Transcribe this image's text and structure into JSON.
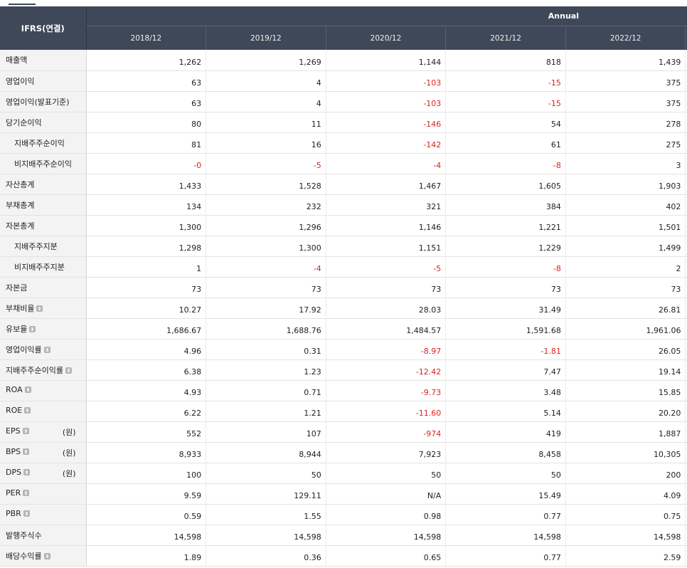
{
  "header": {
    "corner_label": "IFRS(연결)",
    "group_label": "Annual",
    "years": [
      "2018/12",
      "2019/12",
      "2020/12",
      "2021/12",
      "2022/12"
    ]
  },
  "rows": [
    {
      "label": "매출액",
      "sub": false,
      "info": false,
      "unit": "",
      "values": [
        "1,262",
        "1,269",
        "1,144",
        "818",
        "1,439"
      ]
    },
    {
      "label": "영업이익",
      "sub": false,
      "info": false,
      "unit": "",
      "values": [
        "63",
        "4",
        "-103",
        "-15",
        "375"
      ]
    },
    {
      "label": "영업이익(발표기준)",
      "sub": false,
      "info": false,
      "unit": "",
      "values": [
        "63",
        "4",
        "-103",
        "-15",
        "375"
      ]
    },
    {
      "label": "당기순이익",
      "sub": false,
      "info": false,
      "unit": "",
      "values": [
        "80",
        "11",
        "-146",
        "54",
        "278"
      ]
    },
    {
      "label": "지배주주순이익",
      "sub": true,
      "info": false,
      "unit": "",
      "values": [
        "81",
        "16",
        "-142",
        "61",
        "275"
      ]
    },
    {
      "label": "비지배주주순이익",
      "sub": true,
      "info": false,
      "unit": "",
      "values": [
        "-0",
        "-5",
        "-4",
        "-8",
        "3"
      ]
    },
    {
      "label": "자산총계",
      "sub": false,
      "info": false,
      "unit": "",
      "values": [
        "1,433",
        "1,528",
        "1,467",
        "1,605",
        "1,903"
      ]
    },
    {
      "label": "부채총계",
      "sub": false,
      "info": false,
      "unit": "",
      "values": [
        "134",
        "232",
        "321",
        "384",
        "402"
      ]
    },
    {
      "label": "자본총계",
      "sub": false,
      "info": false,
      "unit": "",
      "values": [
        "1,300",
        "1,296",
        "1,146",
        "1,221",
        "1,501"
      ]
    },
    {
      "label": "지배주주지분",
      "sub": true,
      "info": false,
      "unit": "",
      "values": [
        "1,298",
        "1,300",
        "1,151",
        "1,229",
        "1,499"
      ]
    },
    {
      "label": "비지배주주지분",
      "sub": true,
      "info": false,
      "unit": "",
      "values": [
        "1",
        "-4",
        "-5",
        "-8",
        "2"
      ]
    },
    {
      "label": "자본금",
      "sub": false,
      "info": false,
      "unit": "",
      "values": [
        "73",
        "73",
        "73",
        "73",
        "73"
      ]
    },
    {
      "label": "부채비율",
      "sub": false,
      "info": true,
      "unit": "",
      "values": [
        "10.27",
        "17.92",
        "28.03",
        "31.49",
        "26.81"
      ]
    },
    {
      "label": "유보율",
      "sub": false,
      "info": true,
      "unit": "",
      "values": [
        "1,686.67",
        "1,688.76",
        "1,484.57",
        "1,591.68",
        "1,961.06"
      ]
    },
    {
      "label": "영업이익률",
      "sub": false,
      "info": true,
      "unit": "",
      "values": [
        "4.96",
        "0.31",
        "-8.97",
        "-1.81",
        "26.05"
      ]
    },
    {
      "label": "지배주주순이익률",
      "sub": false,
      "info": true,
      "unit": "",
      "values": [
        "6.38",
        "1.23",
        "-12.42",
        "7.47",
        "19.14"
      ]
    },
    {
      "label": "ROA",
      "sub": false,
      "info": true,
      "unit": "",
      "values": [
        "4.93",
        "0.71",
        "-9.73",
        "3.48",
        "15.85"
      ]
    },
    {
      "label": "ROE",
      "sub": false,
      "info": true,
      "unit": "",
      "values": [
        "6.22",
        "1.21",
        "-11.60",
        "5.14",
        "20.20"
      ]
    },
    {
      "label": "EPS",
      "sub": false,
      "info": true,
      "unit": "(원)",
      "values": [
        "552",
        "107",
        "-974",
        "419",
        "1,887"
      ]
    },
    {
      "label": "BPS",
      "sub": false,
      "info": true,
      "unit": "(원)",
      "values": [
        "8,933",
        "8,944",
        "7,923",
        "8,458",
        "10,305"
      ]
    },
    {
      "label": "DPS",
      "sub": false,
      "info": true,
      "unit": "(원)",
      "values": [
        "100",
        "50",
        "50",
        "50",
        "200"
      ]
    },
    {
      "label": "PER",
      "sub": false,
      "info": true,
      "unit": "",
      "values": [
        "9.59",
        "129.11",
        "N/A",
        "15.49",
        "4.09"
      ]
    },
    {
      "label": "PBR",
      "sub": false,
      "info": true,
      "unit": "",
      "values": [
        "0.59",
        "1.55",
        "0.98",
        "0.77",
        "0.75"
      ]
    },
    {
      "label": "발행주식수",
      "sub": false,
      "info": false,
      "unit": "",
      "values": [
        "14,598",
        "14,598",
        "14,598",
        "14,598",
        "14,598"
      ]
    },
    {
      "label": "배당수익률",
      "sub": false,
      "info": true,
      "unit": "",
      "values": [
        "1.89",
        "0.36",
        "0.65",
        "0.77",
        "2.59"
      ]
    }
  ],
  "colors": {
    "header_bg": "#3e4858",
    "negative": "#e02020",
    "label_bg": "#f3f3f3"
  },
  "icons": {
    "info": "info-icon"
  }
}
